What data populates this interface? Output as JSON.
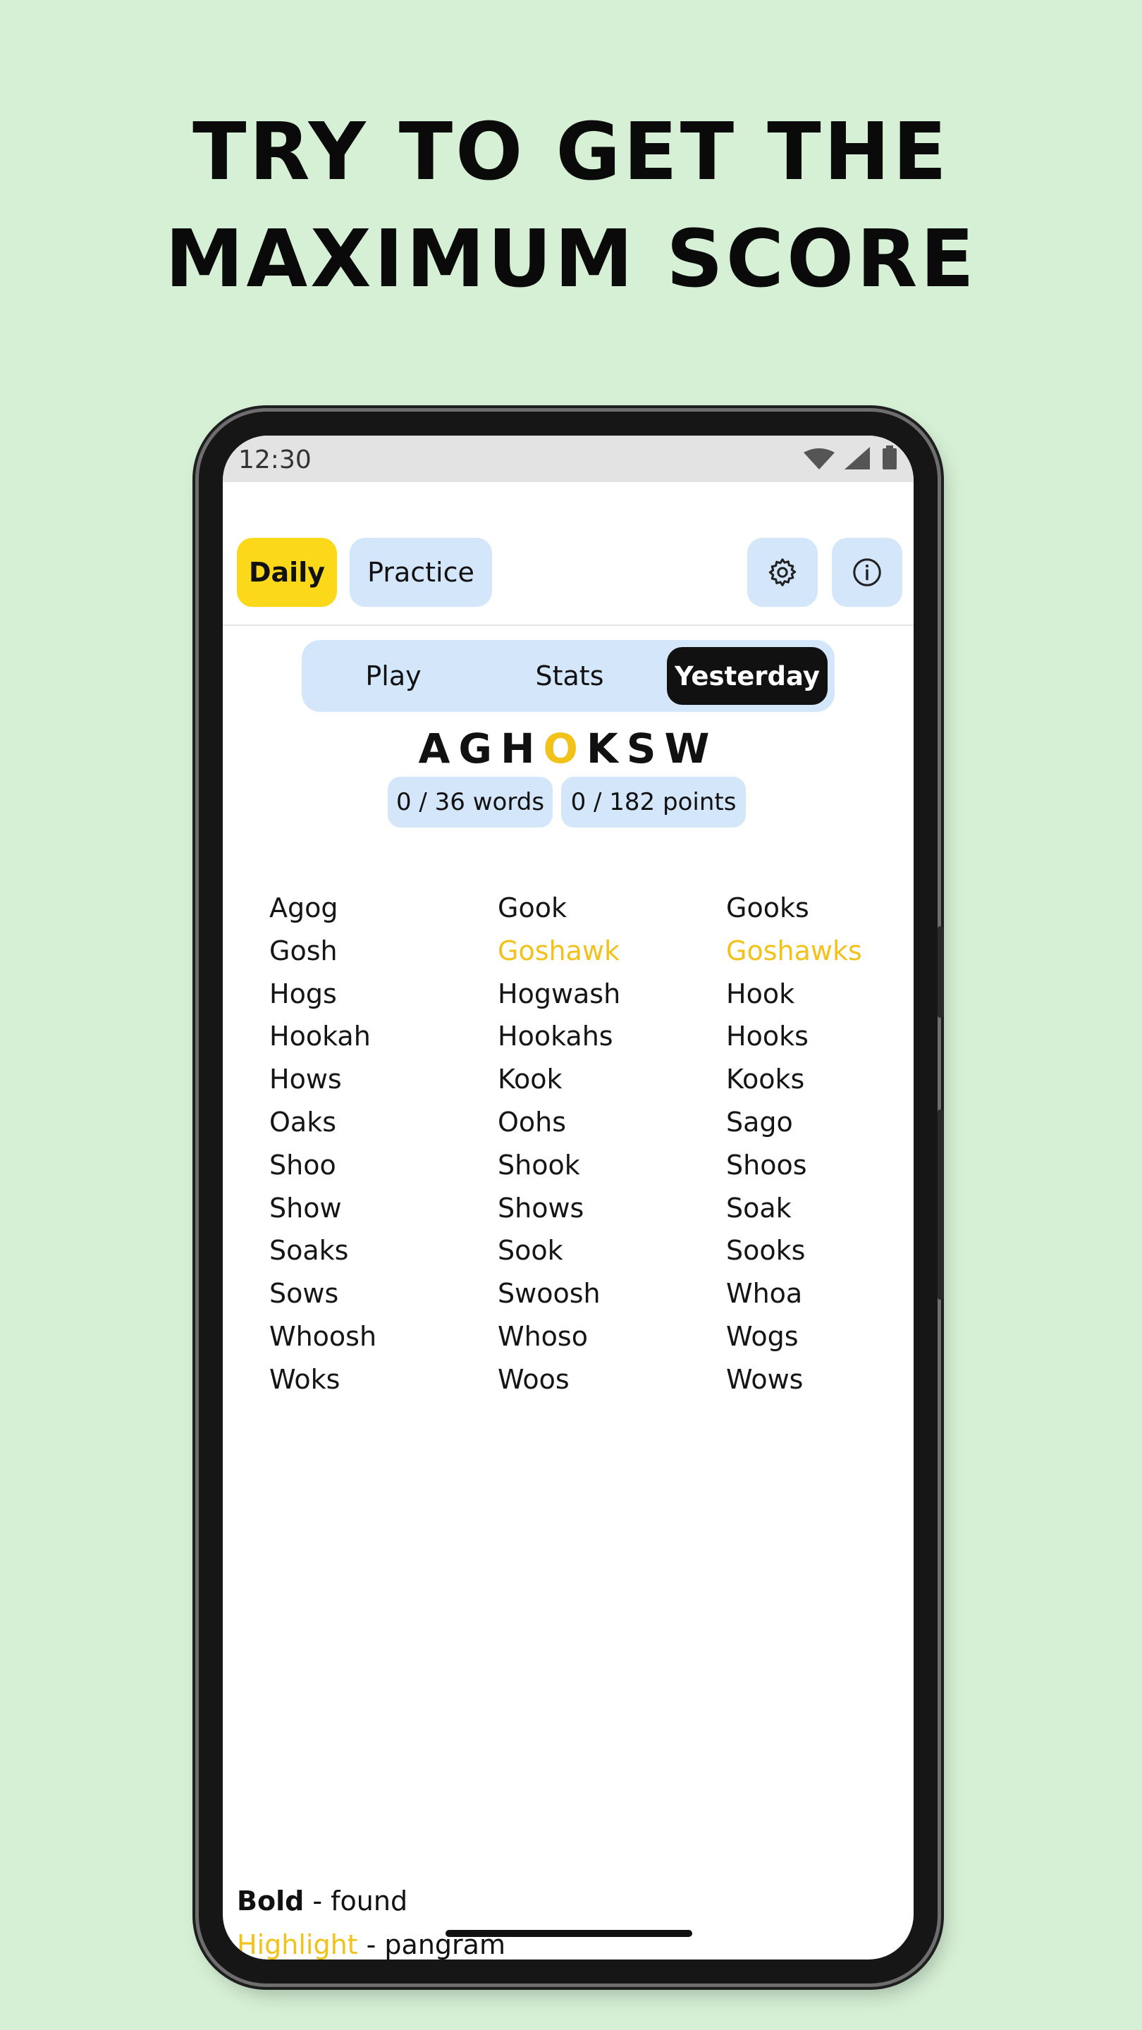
{
  "headline": {
    "line1": "TRY TO GET THE",
    "line2": "MAXIMUM SCORE"
  },
  "status_bar": {
    "time": "12:30",
    "icons": [
      "wifi-icon",
      "signal-icon",
      "battery-icon"
    ]
  },
  "nav": {
    "daily_label": "Daily",
    "practice_label": "Practice",
    "settings_icon": "gear-icon",
    "info_icon": "info-icon"
  },
  "tabs": [
    {
      "label": "Play",
      "active": false
    },
    {
      "label": "Stats",
      "active": false
    },
    {
      "label": "Yesterday",
      "active": true
    }
  ],
  "puzzle": {
    "letters": [
      "A",
      "G",
      "H",
      "O",
      "K",
      "S",
      "W"
    ],
    "center_letter": "O",
    "words_badge": "0 / 36 words",
    "points_badge": "0 / 182 points"
  },
  "words": [
    {
      "text": "Agog",
      "pangram": false
    },
    {
      "text": "Gook",
      "pangram": false
    },
    {
      "text": "Gooks",
      "pangram": false
    },
    {
      "text": "Gosh",
      "pangram": false
    },
    {
      "text": "Goshawk",
      "pangram": true
    },
    {
      "text": "Goshawks",
      "pangram": true
    },
    {
      "text": "Hogs",
      "pangram": false
    },
    {
      "text": "Hogwash",
      "pangram": false
    },
    {
      "text": "Hook",
      "pangram": false
    },
    {
      "text": "Hookah",
      "pangram": false
    },
    {
      "text": "Hookahs",
      "pangram": false
    },
    {
      "text": "Hooks",
      "pangram": false
    },
    {
      "text": "Hows",
      "pangram": false
    },
    {
      "text": "Kook",
      "pangram": false
    },
    {
      "text": "Kooks",
      "pangram": false
    },
    {
      "text": "Oaks",
      "pangram": false
    },
    {
      "text": "Oohs",
      "pangram": false
    },
    {
      "text": "Sago",
      "pangram": false
    },
    {
      "text": "Shoo",
      "pangram": false
    },
    {
      "text": "Shook",
      "pangram": false
    },
    {
      "text": "Shoos",
      "pangram": false
    },
    {
      "text": "Show",
      "pangram": false
    },
    {
      "text": "Shows",
      "pangram": false
    },
    {
      "text": "Soak",
      "pangram": false
    },
    {
      "text": "Soaks",
      "pangram": false
    },
    {
      "text": "Sook",
      "pangram": false
    },
    {
      "text": "Sooks",
      "pangram": false
    },
    {
      "text": "Sows",
      "pangram": false
    },
    {
      "text": "Swoosh",
      "pangram": false
    },
    {
      "text": "Whoa",
      "pangram": false
    },
    {
      "text": "Whoosh",
      "pangram": false
    },
    {
      "text": "Whoso",
      "pangram": false
    },
    {
      "text": "Wogs",
      "pangram": false
    },
    {
      "text": "Woks",
      "pangram": false
    },
    {
      "text": "Woos",
      "pangram": false
    },
    {
      "text": "Wows",
      "pangram": false
    }
  ],
  "legend": {
    "bold_term": "Bold",
    "bold_desc": " - found",
    "highlight_term": "Highlight",
    "highlight_desc": " - pangram"
  },
  "colors": {
    "background": "#d5f0d5",
    "accent_yellow": "#fbd81a",
    "pill_blue": "#d4e6fa",
    "pangram": "#f3c21a"
  }
}
